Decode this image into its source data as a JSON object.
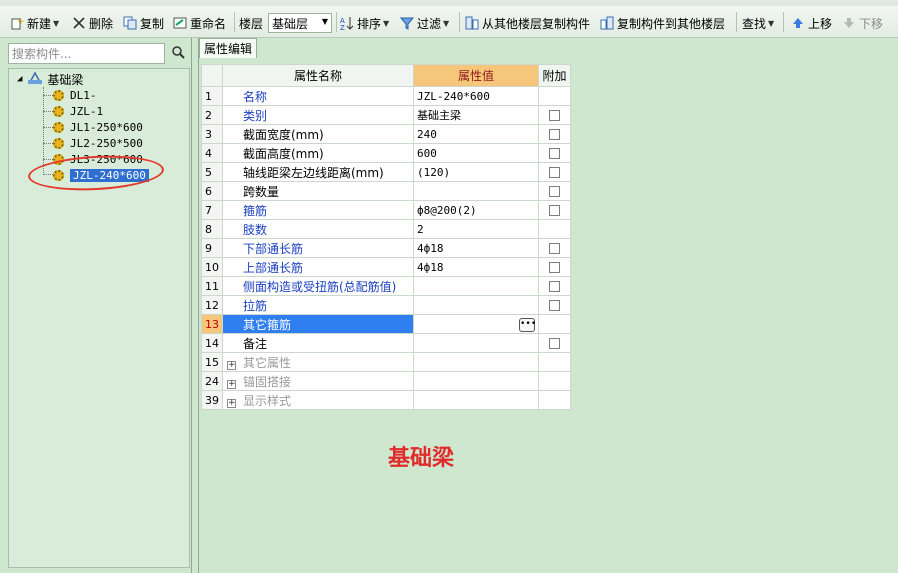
{
  "toolbar": {
    "new_label": "新建",
    "delete_label": "删除",
    "copy_label": "复制",
    "rename_label": "重命名",
    "floor_label": "楼层",
    "floor_value": "基础层",
    "sort_label": "排序",
    "filter_label": "过滤",
    "copy_from_floor_label": "从其他楼层复制构件",
    "copy_to_floor_label": "复制构件到其他楼层",
    "find_label": "查找",
    "move_up_label": "上移",
    "move_down_label": "下移"
  },
  "sidebar": {
    "search_placeholder": "搜索构件...",
    "root_label": "基础梁",
    "items": [
      {
        "label": "DL1-"
      },
      {
        "label": "JZL-1"
      },
      {
        "label": "JL1-250*600"
      },
      {
        "label": "JL2-250*500"
      },
      {
        "label": "JL3-250*600"
      },
      {
        "label": "JZL-240*600"
      }
    ],
    "selected_index": 5
  },
  "tabs": [
    {
      "label": "属性编辑"
    }
  ],
  "grid": {
    "headers": {
      "name": "属性名称",
      "value": "属性值",
      "extra": "附加"
    },
    "rows": [
      {
        "num": "1",
        "name": "名称",
        "value": "JZL-240*600",
        "checkbox": false,
        "blue": true
      },
      {
        "num": "2",
        "name": "类别",
        "value": "基础主梁",
        "checkbox": true,
        "blue": true
      },
      {
        "num": "3",
        "name": "截面宽度(mm)",
        "value": "240",
        "checkbox": true,
        "blue": false
      },
      {
        "num": "4",
        "name": "截面高度(mm)",
        "value": "600",
        "checkbox": true,
        "blue": false
      },
      {
        "num": "5",
        "name": "轴线距梁左边线距离(mm)",
        "value": "(120)",
        "checkbox": true,
        "blue": false
      },
      {
        "num": "6",
        "name": "跨数量",
        "value": "",
        "checkbox": true,
        "blue": false
      },
      {
        "num": "7",
        "name": "箍筋",
        "value": "ф8@200(2)",
        "checkbox": true,
        "blue": true
      },
      {
        "num": "8",
        "name": "肢数",
        "value": "2",
        "checkbox": false,
        "blue": true
      },
      {
        "num": "9",
        "name": "下部通长筋",
        "value": "4ф18",
        "checkbox": true,
        "blue": true
      },
      {
        "num": "10",
        "name": "上部通长筋",
        "value": "4ф18",
        "checkbox": true,
        "blue": true
      },
      {
        "num": "11",
        "name": "侧面构造或受扭筋(总配筋值)",
        "value": "",
        "checkbox": true,
        "blue": true
      },
      {
        "num": "12",
        "name": "拉筋",
        "value": "",
        "checkbox": true,
        "blue": true
      },
      {
        "num": "13",
        "name": "其它箍筋",
        "value": "",
        "checkbox": false,
        "blue": false,
        "selected": true
      },
      {
        "num": "14",
        "name": "备注",
        "value": "",
        "checkbox": true,
        "blue": false
      },
      {
        "num": "15",
        "name": "其它属性",
        "value": "",
        "checkbox": false,
        "group": true
      },
      {
        "num": "24",
        "name": "锚固搭接",
        "value": "",
        "checkbox": false,
        "group": true
      },
      {
        "num": "39",
        "name": "显示样式",
        "value": "",
        "checkbox": false,
        "group": true
      }
    ]
  },
  "overlay_label": "基础梁",
  "colors": {
    "background": "#cfe6cf",
    "selection": "#2f7ff0",
    "header_highlight": "#f6c77a",
    "annotation_red": "#e23a2d"
  }
}
